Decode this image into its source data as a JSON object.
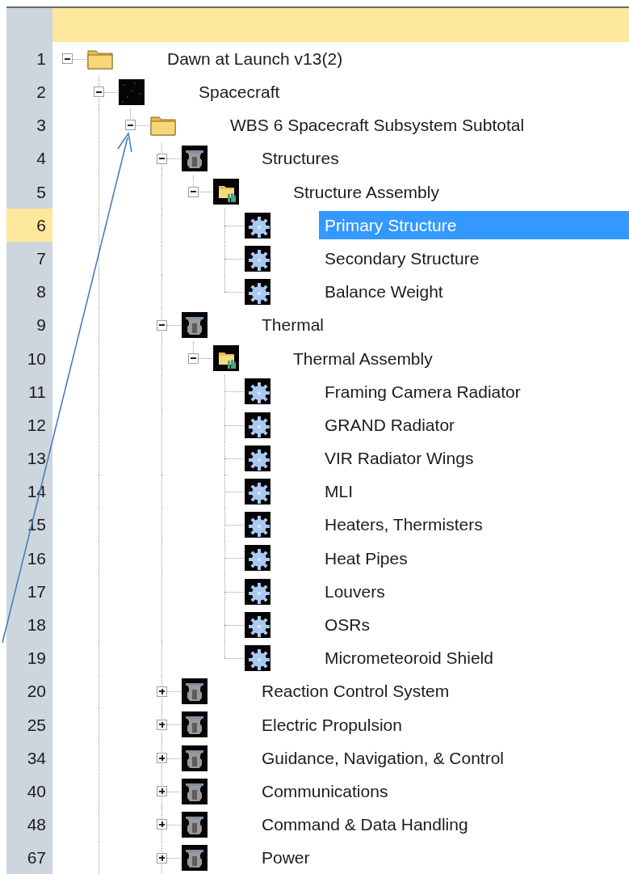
{
  "tree": [
    {
      "row": "1",
      "label": "Dawn at Launch v13(2)",
      "kind": "folder",
      "expanded": true,
      "selected": false,
      "children": [
        {
          "row": "2",
          "label": "Spacecraft",
          "kind": "starfield",
          "expanded": true,
          "selected": false,
          "continues": true,
          "children": [
            {
              "row": "3",
              "label": "WBS 6 Spacecraft Subsystem Subtotal",
              "kind": "folder",
              "expanded": true,
              "selected": false,
              "children": [
                {
                  "row": "4",
                  "label": "Structures",
                  "kind": "figure",
                  "expanded": true,
                  "selected": false,
                  "children": [
                    {
                      "row": "5",
                      "label": "Structure Assembly",
                      "kind": "assembly",
                      "expanded": true,
                      "selected": false,
                      "children": [
                        {
                          "row": "6",
                          "label": "Primary Structure",
                          "kind": "gear",
                          "selected": true
                        },
                        {
                          "row": "7",
                          "label": "Secondary Structure",
                          "kind": "gear",
                          "selected": false
                        },
                        {
                          "row": "8",
                          "label": "Balance Weight",
                          "kind": "gear",
                          "selected": false
                        }
                      ]
                    }
                  ]
                },
                {
                  "row": "9",
                  "label": "Thermal",
                  "kind": "figure",
                  "expanded": true,
                  "selected": false,
                  "children": [
                    {
                      "row": "10",
                      "label": "Thermal Assembly",
                      "kind": "assembly",
                      "expanded": true,
                      "selected": false,
                      "children": [
                        {
                          "row": "11",
                          "label": "Framing Camera Radiator",
                          "kind": "gear",
                          "selected": false
                        },
                        {
                          "row": "12",
                          "label": "GRAND Radiator",
                          "kind": "gear",
                          "selected": false
                        },
                        {
                          "row": "13",
                          "label": "VIR Radiator Wings",
                          "kind": "gear",
                          "selected": false
                        },
                        {
                          "row": "14",
                          "label": "MLI",
                          "kind": "gear",
                          "selected": false
                        },
                        {
                          "row": "15",
                          "label": "Heaters, Thermisters",
                          "kind": "gear",
                          "selected": false
                        },
                        {
                          "row": "16",
                          "label": "Heat Pipes",
                          "kind": "gear",
                          "selected": false
                        },
                        {
                          "row": "17",
                          "label": "Louvers",
                          "kind": "gear",
                          "selected": false
                        },
                        {
                          "row": "18",
                          "label": "OSRs",
                          "kind": "gear",
                          "selected": false
                        },
                        {
                          "row": "19",
                          "label": "Micrometeoroid Shield",
                          "kind": "gear",
                          "selected": false
                        }
                      ]
                    }
                  ]
                },
                {
                  "row": "20",
                  "label": "Reaction Control System",
                  "kind": "figure",
                  "expanded": false,
                  "selected": false
                },
                {
                  "row": "25",
                  "label": "Electric Propulsion",
                  "kind": "figure",
                  "expanded": false,
                  "selected": false
                },
                {
                  "row": "34",
                  "label": "Guidance, Navigation, & Control",
                  "kind": "figure",
                  "expanded": false,
                  "selected": false
                },
                {
                  "row": "40",
                  "label": "Communications",
                  "kind": "figure",
                  "expanded": false,
                  "selected": false
                },
                {
                  "row": "48",
                  "label": "Command & Data Handling",
                  "kind": "figure",
                  "expanded": false,
                  "selected": false
                },
                {
                  "row": "67",
                  "label": "Power",
                  "kind": "figure",
                  "expanded": false,
                  "selected": false,
                  "continues": true
                }
              ]
            }
          ]
        }
      ]
    }
  ]
}
